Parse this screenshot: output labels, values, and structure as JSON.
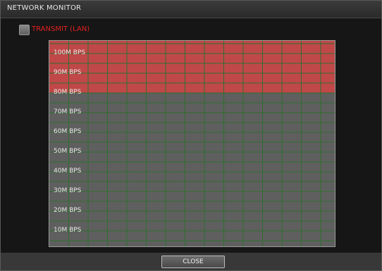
{
  "window": {
    "title": "NETWORK MONITOR"
  },
  "transmit": {
    "label": "TRANSMIT (LAN)",
    "checked": false,
    "label_color": "#e0201e"
  },
  "chart": {
    "tick_labels": [
      "100M BPS",
      "90M BPS",
      "80M BPS",
      "70M BPS",
      "60M BPS",
      "50M BPS",
      "40M BPS",
      "30M BPS",
      "20M BPS",
      "10M BPS"
    ],
    "highlight_color": "#c04848",
    "background_color": "#5f5f5f",
    "grid_color": "#2f6f2f"
  },
  "footer": {
    "close_label": "CLOSE"
  },
  "chart_data": {
    "type": "area",
    "title": "",
    "xlabel": "",
    "ylabel": "",
    "ylim": [
      0,
      100
    ],
    "y_ticks": [
      10,
      20,
      30,
      40,
      50,
      60,
      70,
      80,
      90,
      100
    ],
    "grid": true,
    "highlighted_band": [
      80,
      100
    ]
  }
}
